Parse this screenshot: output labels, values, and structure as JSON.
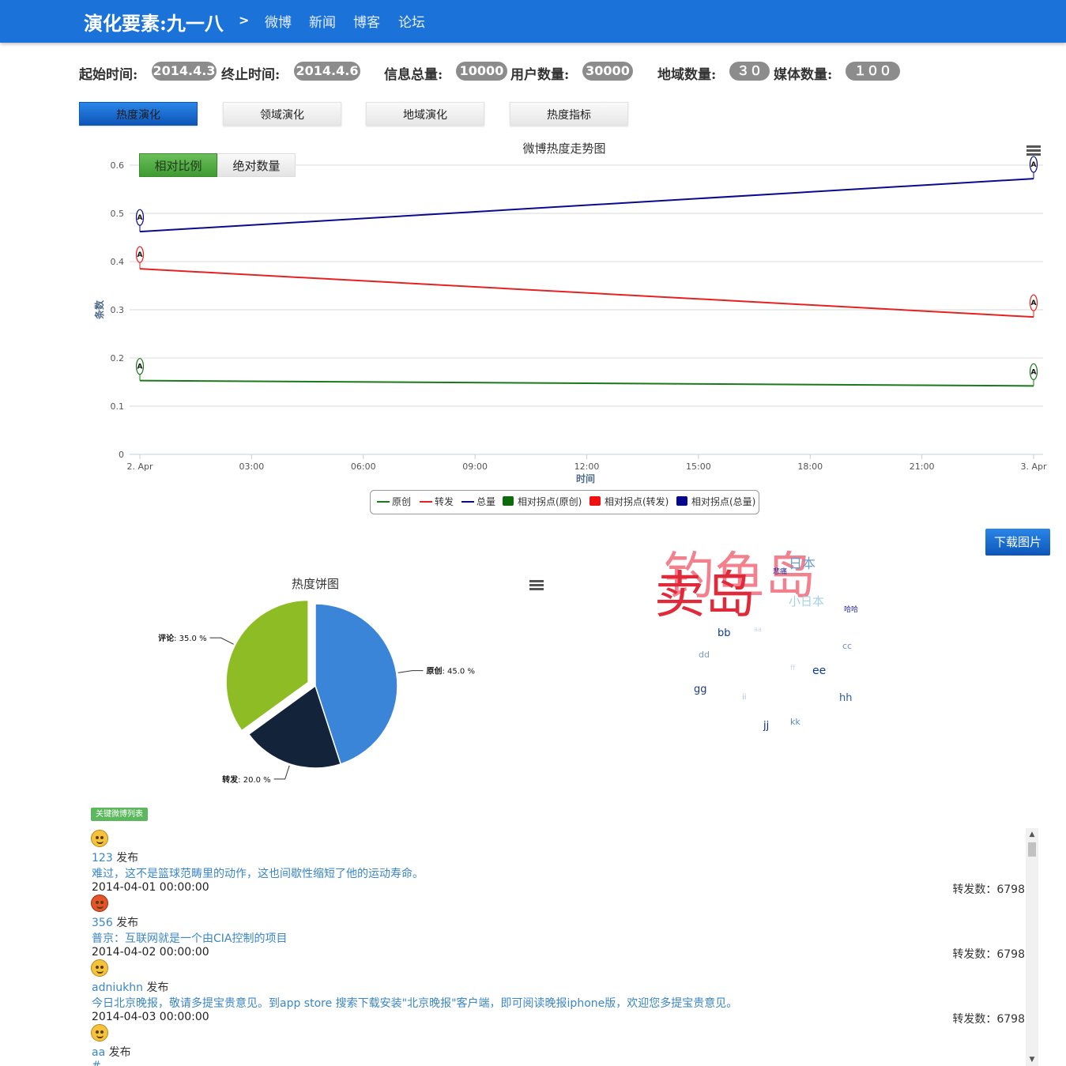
{
  "header": {
    "brand": "演化要素:九一八",
    "separator": ">",
    "nav": [
      "微博",
      "新闻",
      "博客",
      "论坛"
    ]
  },
  "stats": {
    "start_label": "起始时间:",
    "start_value": "2014.4.3",
    "end_label": "终止时间:",
    "end_value": "2014.4.6",
    "total_label": "信息总量:",
    "total_value": "10000",
    "users_label": "用户数量:",
    "users_value": "30000",
    "regions_label": "地域数量:",
    "regions_value": "３０",
    "media_label": "媒体数量:",
    "media_value": "１００"
  },
  "tabs": [
    "热度演化",
    "领域演化",
    "地域演化",
    "热度指标"
  ],
  "toggle": {
    "relative": "相对比例",
    "absolute": "绝对数量"
  },
  "chart_data": [
    {
      "type": "line",
      "title": "微博热度走势图",
      "xlabel": "时间",
      "ylabel": "条数",
      "x_ticks": [
        "2. Apr",
        "03:00",
        "06:00",
        "09:00",
        "12:00",
        "15:00",
        "18:00",
        "21:00",
        "3. Apr"
      ],
      "y_ticks": [
        "0",
        "0.1",
        "0.2",
        "0.3",
        "0.4",
        "0.5",
        "0.6"
      ],
      "ylim": [
        0,
        0.6
      ],
      "x": [
        "2014-04-02 00:00",
        "2014-04-03 00:00"
      ],
      "series": [
        {
          "name": "原创",
          "values": [
            0.153,
            0.142
          ],
          "color": "#1a7a1a"
        },
        {
          "name": "转发",
          "values": [
            0.385,
            0.285
          ],
          "color": "#e52222"
        },
        {
          "name": "总量",
          "values": [
            0.462,
            0.572
          ],
          "color": "#0a0a8c"
        }
      ],
      "flags": [
        {
          "series": "相对拐点(原创)",
          "color": "#1a7a1a",
          "label": "A",
          "x": [
            "2014-04-02 00:00",
            "2014-04-03 00:00"
          ]
        },
        {
          "series": "相对拐点(转发)",
          "color": "#e52222",
          "label": "A",
          "x": [
            "2014-04-02 00:00",
            "2014-04-03 00:00"
          ]
        },
        {
          "series": "相对拐点(总量)",
          "color": "#0a0a8c",
          "label": "A",
          "x": [
            "2014-04-02 00:00",
            "2014-04-03 00:00"
          ]
        }
      ],
      "legend": [
        {
          "label": "原创",
          "kind": "line",
          "color": "#1a7a1a"
        },
        {
          "label": "转发",
          "kind": "line",
          "color": "#e52222"
        },
        {
          "label": "总量",
          "kind": "line",
          "color": "#0a0a8c"
        },
        {
          "label": "相对拐点(原创)",
          "kind": "box",
          "color": "#0d6b0d"
        },
        {
          "label": "相对拐点(转发)",
          "kind": "box",
          "color": "#ee1111"
        },
        {
          "label": "相对拐点(总量)",
          "kind": "box",
          "color": "#08088a"
        }
      ],
      "legend_position": "bottom-center",
      "grid": true
    },
    {
      "type": "pie",
      "title": "热度饼图",
      "slices": [
        {
          "name": "原创",
          "value": 45.0,
          "label": "45.0 %",
          "color": "#3a85d8"
        },
        {
          "name": "转发",
          "value": 20.0,
          "label": "20.0 %",
          "color": "#13233a"
        },
        {
          "name": "评论",
          "value": 35.0,
          "label": "35.0 %",
          "color": "#8dbc24"
        }
      ]
    }
  ],
  "download_label": "下载图片",
  "word_cloud": [
    {
      "text": "钓鱼岛",
      "size": 64,
      "color": "#f06a7a",
      "rot": 0
    },
    {
      "text": "卖岛",
      "size": 64,
      "color": "#e02a3a",
      "rot": 0
    },
    {
      "text": "日本",
      "size": 17,
      "color": "#6aa0c8",
      "rot": 0
    },
    {
      "text": "悲痛",
      "size": 9,
      "color": "#2a2aa8",
      "rot": 0
    },
    {
      "text": "小日本",
      "size": 15,
      "color": "#a8d0e6",
      "rot": 0
    },
    {
      "text": "哈哈",
      "size": 9,
      "color": "#2a2aa8",
      "rot": 0
    },
    {
      "text": "bb",
      "size": 13,
      "color": "#0a3a9a",
      "rot": 0
    },
    {
      "text": "aa",
      "size": 8,
      "color": "#c8d8e8",
      "rot": 0
    },
    {
      "text": "dd",
      "size": 11,
      "color": "#7a9ac8",
      "rot": 0
    },
    {
      "text": "cc",
      "size": 11,
      "color": "#6a90c8",
      "rot": 0
    },
    {
      "text": "ff",
      "size": 9,
      "color": "#c8d8e8",
      "rot": 0
    },
    {
      "text": "ee",
      "size": 14,
      "color": "#0a3a9a",
      "rot": 0
    },
    {
      "text": "gg",
      "size": 13,
      "color": "#1a3a7a",
      "rot": 0
    },
    {
      "text": "ii",
      "size": 10,
      "color": "#a8c0e0",
      "rot": 0
    },
    {
      "text": "hh",
      "size": 13,
      "color": "#2a5aa8",
      "rot": 0
    },
    {
      "text": "jj",
      "size": 13,
      "color": "#0a2a7a",
      "rot": 0
    },
    {
      "text": "kk",
      "size": 11,
      "color": "#5a8ac8",
      "rot": 0
    }
  ],
  "feed": {
    "badge": "关键微博列表",
    "published": "发布",
    "retweet_label": "转发数：",
    "items": [
      {
        "mood": "sad",
        "user": "123",
        "text": "难过，这不是篮球范畴里的动作，这也间歇性缩短了他的运动寿命。",
        "time": "2014-04-01 00:00:00",
        "retweets": "6798"
      },
      {
        "mood": "angry",
        "user": "356",
        "text": "普京：互联网就是一个由CIA控制的项目",
        "time": "2014-04-02 00:00:00",
        "retweets": "6798"
      },
      {
        "mood": "happy",
        "user": "adniukhn",
        "text": "今日北京晚报，敬请多提宝贵意见。到app store 搜索下载安装\"北京晚报\"客户端，即可阅读晚报iphone版，欢迎您多提宝贵意见。",
        "time": "2014-04-03 00:00:00",
        "retweets": "6798"
      },
      {
        "mood": "happy",
        "user": "aa",
        "text": "#",
        "time": "",
        "retweets": ""
      }
    ]
  }
}
